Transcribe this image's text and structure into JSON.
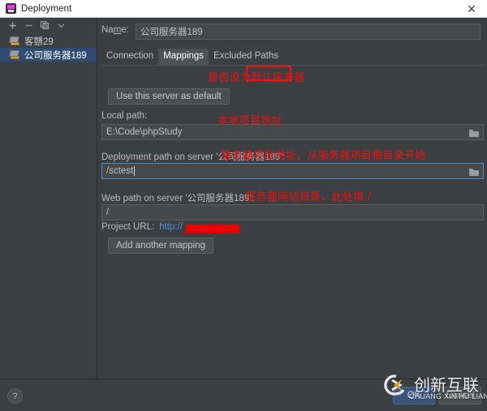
{
  "window": {
    "title": "Deployment",
    "icon": "deployment-icon",
    "close_label": "✕"
  },
  "sidebar": {
    "toolbar": [
      {
        "name": "add-server-button",
        "glyph": "+"
      },
      {
        "name": "remove-server-button",
        "glyph": "−"
      },
      {
        "name": "copy-server-button",
        "glyph": "copy"
      },
      {
        "name": "more-options-button",
        "glyph": "chevron-down"
      }
    ],
    "items": [
      {
        "label": "客戇29",
        "selected": false
      },
      {
        "label": "公司服务器189",
        "selected": true
      }
    ]
  },
  "main": {
    "name_label": "Name:",
    "name_value": "公司服务器189",
    "tabs": [
      {
        "label": "Connection",
        "active": false
      },
      {
        "label": "Mappings",
        "active": true
      },
      {
        "label": "Excluded Paths",
        "active": false
      }
    ],
    "use_default_button": "Use this server as default",
    "local_path_label": "Local path:",
    "local_path_value": "E:\\Code\\phpStudy",
    "deploy_path_label": "Deployment path on server '公司服务器189':",
    "deploy_path_value": "/sctest",
    "web_path_label": "Web path on server '公司服务器189':",
    "web_path_value": "/",
    "project_url_label": "Project URL:",
    "project_url_value": "http://",
    "add_mapping_button": "Add another mapping",
    "browse_icon": "folder-icon"
  },
  "annotations": [
    {
      "id": "annot-default",
      "text": "是否设为默认服务器"
    },
    {
      "id": "annot-local",
      "text": "本地项目地址"
    },
    {
      "id": "annot-deploy",
      "text": "服务器项目地址，从服务器项目根目录开始"
    },
    {
      "id": "annot-web",
      "text": "服务器网站目录，此处填 /"
    }
  ],
  "footer": {
    "help_label": "?",
    "ok_label": "OK",
    "cancel_label": "Cancel"
  },
  "watermark": {
    "chinese": "创新互联",
    "pinyin": "CHUANG XIN HU LIAN"
  },
  "colors": {
    "accent_red": "#f01010",
    "link_blue": "#4f8fd4",
    "focus_blue": "#4a88c7",
    "selection_blue": "#2f4b72",
    "panel_bg": "#3c3f41",
    "input_bg": "#45494a"
  }
}
